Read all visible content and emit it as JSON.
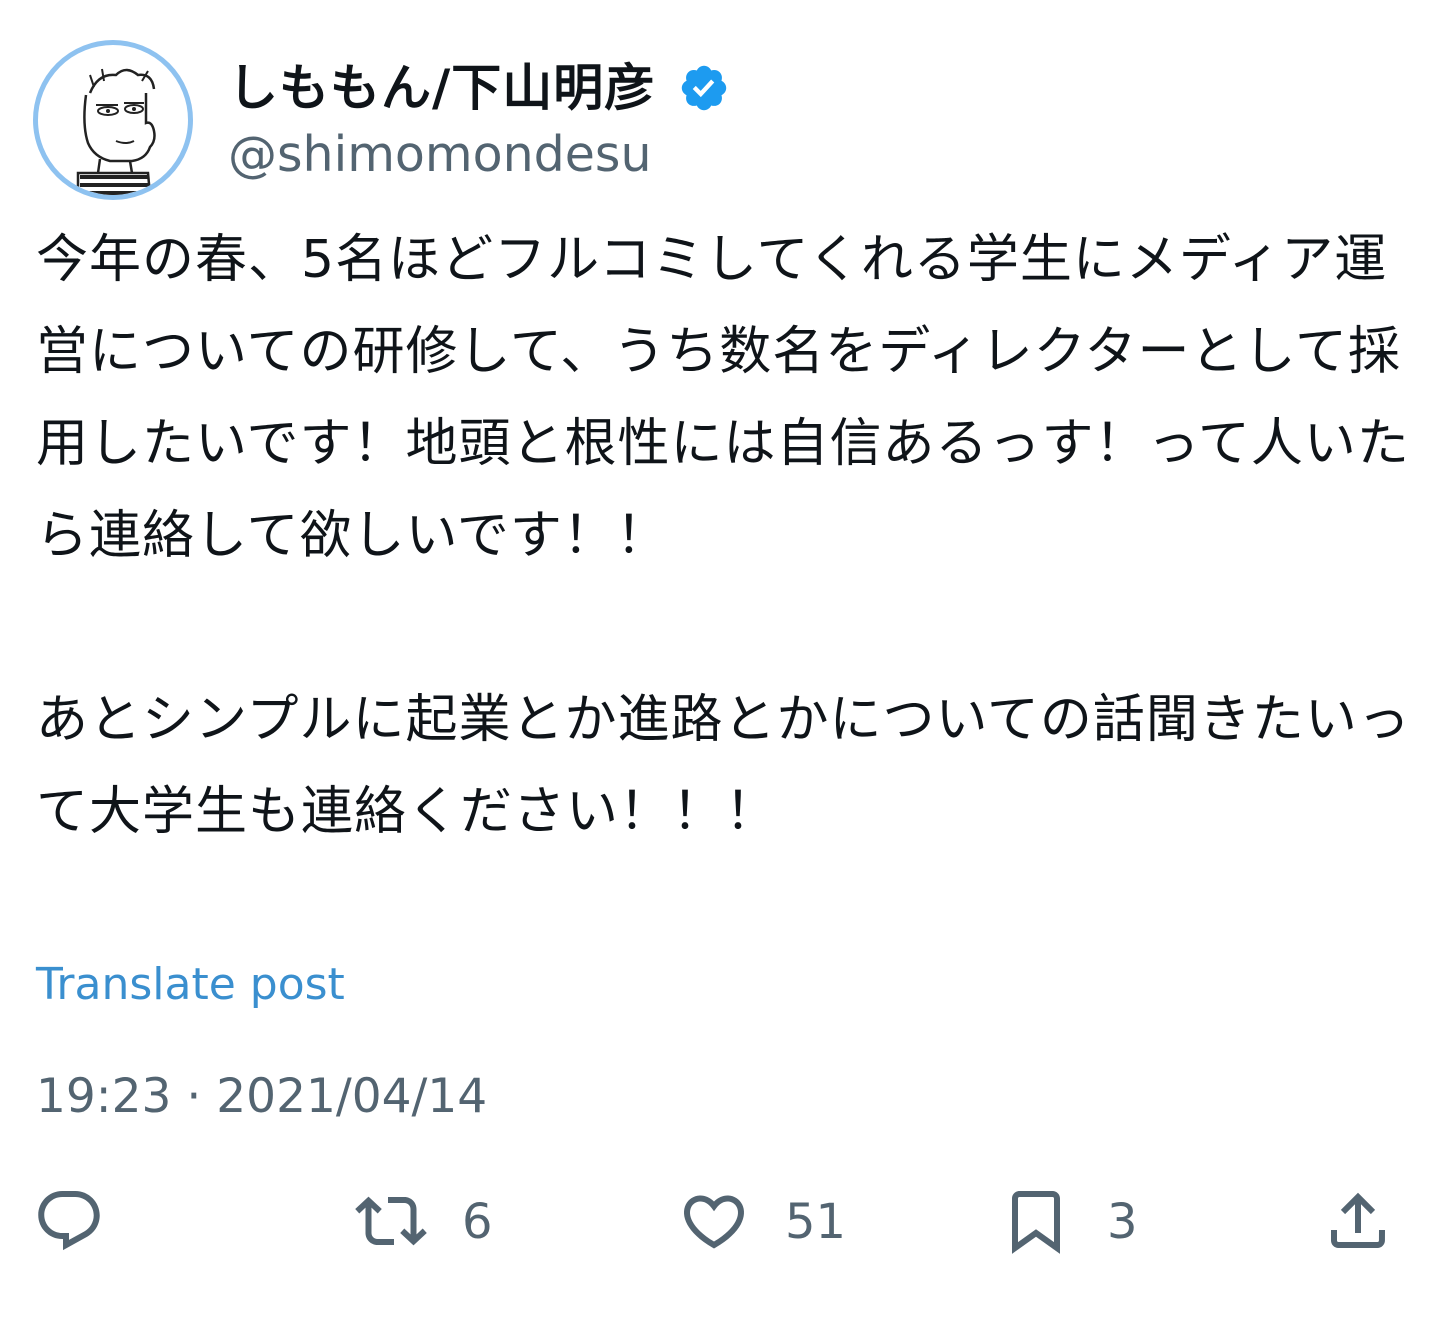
{
  "author": {
    "display_name": "しももん/下山明彦",
    "handle": "@shimomondesu",
    "verified": true,
    "avatar_icon": "cartoon-character-avatar"
  },
  "post": {
    "text": "今年の春、5名ほどフルコミしてくれる学生にメディア運営についての研修して、うち数名をディレクターとして採用したいです！地頭と根性には自信あるっす！って人いたら連絡して欲しいです！！\n\nあとシンプルに起業とか進路とかについての話聞きたいって大学生も連絡ください！！！",
    "translate_label": "Translate post",
    "timestamp": "19:23 · 2021/04/14"
  },
  "actions": {
    "reply": {
      "icon": "reply-icon"
    },
    "repost": {
      "icon": "repost-icon",
      "count": "6"
    },
    "like": {
      "icon": "heart-icon",
      "count": "51"
    },
    "bookmark": {
      "icon": "bookmark-icon",
      "count": "3"
    },
    "share": {
      "icon": "share-icon"
    }
  },
  "colors": {
    "text": "#0f1419",
    "secondary": "#536471",
    "link": "#3a8fcf",
    "verified": "#1d9bf0",
    "avatar_ring": "#8ec2f0"
  }
}
